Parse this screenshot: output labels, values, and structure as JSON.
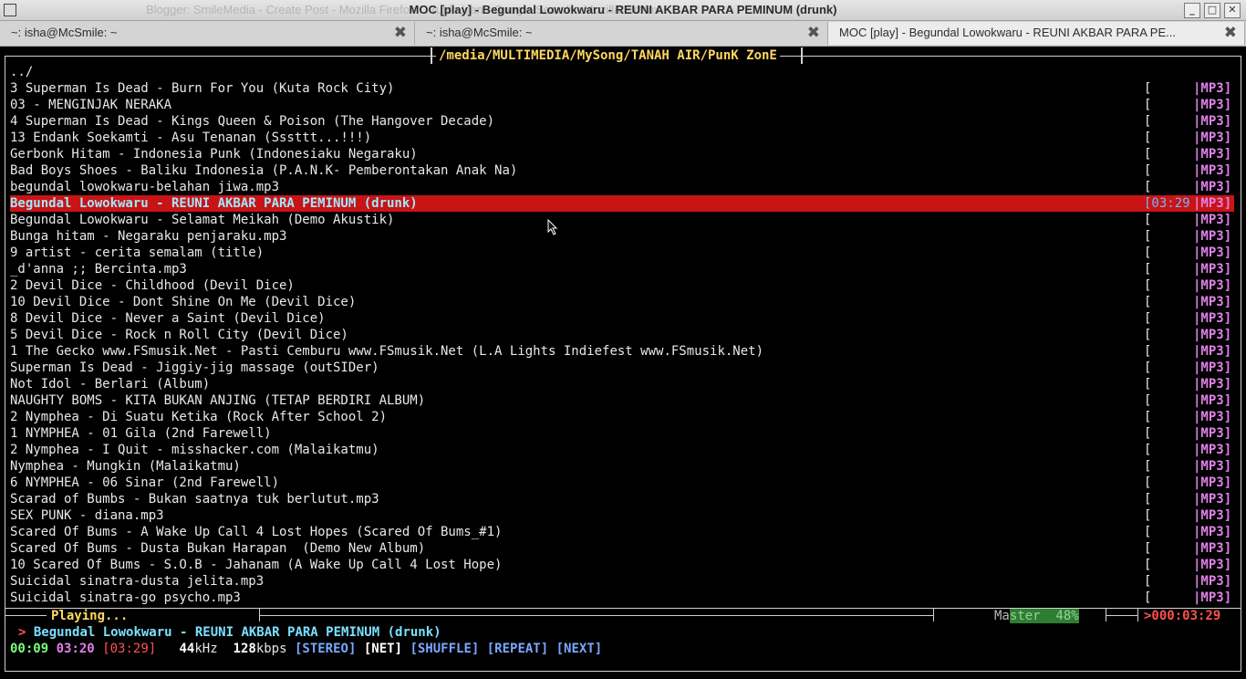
{
  "window": {
    "title": "MOC [play] - Begundal Lowokwaru - REUNI AKBAR PARA PEMINUM (drunk)",
    "ghost_title": "Blogger: SmileMedia - Create Post - Mozilla Firefox   ...   ruble lsan - Google Search - Mozilla Firefox"
  },
  "tabs": [
    {
      "label": "~: isha@McSmile: ~",
      "close": "✖"
    },
    {
      "label": "~: isha@McSmile: ~",
      "close": "✖"
    },
    {
      "label": "MOC [play] - Begundal Lowokwaru - REUNI AKBAR PARA PE...",
      "close": "✖"
    }
  ],
  "browser": {
    "path": "/media/MULTIMEDIA/MySong/TANAH AIR/PunK ZonE",
    "updir": "../",
    "items": [
      {
        "name": "3 Superman Is Dead - Burn For You (Kuta Rock City)",
        "time": "[     ",
        "fmt": "|MP3]"
      },
      {
        "name": "03 - MENGINJAK NERAKA",
        "time": "[     ",
        "fmt": "|MP3]"
      },
      {
        "name": "4 Superman Is Dead - Kings Queen & Poison (The Hangover Decade)",
        "time": "[     ",
        "fmt": "|MP3]"
      },
      {
        "name": "13 Endank Soekamti - Asu Tenanan (Sssttt...!!!)",
        "time": "[     ",
        "fmt": "|MP3]"
      },
      {
        "name": "Gerbonk Hitam - Indonesia Punk (Indonesiaku Negaraku)",
        "time": "[     ",
        "fmt": "|MP3]"
      },
      {
        "name": "Bad Boys Shoes - Baliku Indonesia (P.A.N.K- Pemberontakan Anak Na)",
        "time": "[     ",
        "fmt": "|MP3]"
      },
      {
        "name": "begundal lowokwaru-belahan jiwa.mp3",
        "time": "[     ",
        "fmt": "|MP3]"
      },
      {
        "name": "Begundal Lowokwaru - REUNI AKBAR PARA PEMINUM (drunk)",
        "time": "[03:29",
        "fmt": "|MP3]"
      },
      {
        "name": "Begundal Lowokwaru - Selamat Meikah (Demo Akustik)",
        "time": "[     ",
        "fmt": "|MP3]"
      },
      {
        "name": "Bunga hitam - Negaraku penjaraku.mp3",
        "time": "[     ",
        "fmt": "|MP3]"
      },
      {
        "name": "9 artist - cerita semalam (title)",
        "time": "[     ",
        "fmt": "|MP3]"
      },
      {
        "name": "_d'anna ;; Bercinta.mp3",
        "time": "[     ",
        "fmt": "|MP3]"
      },
      {
        "name": "2 Devil Dice - Childhood (Devil Dice)",
        "time": "[     ",
        "fmt": "|MP3]"
      },
      {
        "name": "10 Devil Dice - Dont Shine On Me (Devil Dice)",
        "time": "[     ",
        "fmt": "|MP3]"
      },
      {
        "name": "8 Devil Dice - Never a Saint (Devil Dice)",
        "time": "[     ",
        "fmt": "|MP3]"
      },
      {
        "name": "5 Devil Dice - Rock n Roll City (Devil Dice)",
        "time": "[     ",
        "fmt": "|MP3]"
      },
      {
        "name": "1 The Gecko www.FSmusik.Net - Pasti Cemburu www.FSmusik.Net (L.A Lights Indiefest www.FSmusik.Net)",
        "time": "[     ",
        "fmt": "|MP3]"
      },
      {
        "name": "Superman Is Dead - Jiggiy-jig massage (outSIDer)",
        "time": "[     ",
        "fmt": "|MP3]"
      },
      {
        "name": "Not Idol - Berlari (Album)",
        "time": "[     ",
        "fmt": "|MP3]"
      },
      {
        "name": "NAUGHTY BOMS - KITA BUKAN ANJING (TETAP BERDIRI ALBUM)",
        "time": "[     ",
        "fmt": "|MP3]"
      },
      {
        "name": "2 Nymphea - Di Suatu Ketika (Rock After School 2)",
        "time": "[     ",
        "fmt": "|MP3]"
      },
      {
        "name": "1 NYMPHEA - 01 Gila (2nd Farewell)",
        "time": "[     ",
        "fmt": "|MP3]"
      },
      {
        "name": "2 Nymphea - I Quit - misshacker.com (Malaikatmu)",
        "time": "[     ",
        "fmt": "|MP3]"
      },
      {
        "name": "Nymphea - Mungkin (Malaikatmu)",
        "time": "[     ",
        "fmt": "|MP3]"
      },
      {
        "name": "6 NYMPHEA - 06 Sinar (2nd Farewell)",
        "time": "[     ",
        "fmt": "|MP3]"
      },
      {
        "name": "Scarad of Bumbs - Bukan saatnya tuk berlutut.mp3",
        "time": "[     ",
        "fmt": "|MP3]"
      },
      {
        "name": "SEX PUNK - diana.mp3",
        "time": "[     ",
        "fmt": "|MP3]"
      },
      {
        "name": "Scared Of Bums - A Wake Up Call 4 Lost Hopes (Scared Of Bums_#1)",
        "time": "[     ",
        "fmt": "|MP3]"
      },
      {
        "name": "Scared Of Bums - Dusta Bukan Harapan  (Demo New Album)",
        "time": "[     ",
        "fmt": "|MP3]"
      },
      {
        "name": "10 Scared Of Bums - S.O.B - Jahanam (A Wake Up Call 4 Lost Hope)",
        "time": "[     ",
        "fmt": "|MP3]"
      },
      {
        "name": "Suicidal sinatra-dusta jelita.mp3",
        "time": "[     ",
        "fmt": "|MP3]"
      },
      {
        "name": "Suicidal sinatra-go psycho.mp3",
        "time": "[     ",
        "fmt": "|MP3]"
      }
    ],
    "selected_index": 7
  },
  "status": {
    "state": "Playing...",
    "mixer_label_a": "Ma",
    "mixer_label_b": "ster  48%",
    "mixer_percent": 48,
    "total_time": ">000:03:29",
    "arrow": ">",
    "now_title": "Begundal Lowokwaru - REUNI AKBAR PARA PEMINUM (drunk)",
    "elapsed": "00:09",
    "remaining": "03:20",
    "duration": "[03:29]",
    "rate": "44",
    "rate_unit": "kHz",
    "bitrate": "128",
    "bitrate_unit": "kbps",
    "stereo": "[STEREO]",
    "net": "[NET]",
    "shuffle": "[SHUFFLE]",
    "repeat": "[REPEAT]",
    "next": "[NEXT]"
  },
  "colors": {
    "selection": "#c81414",
    "path": "#ffd75f",
    "format": "#e080e8"
  }
}
